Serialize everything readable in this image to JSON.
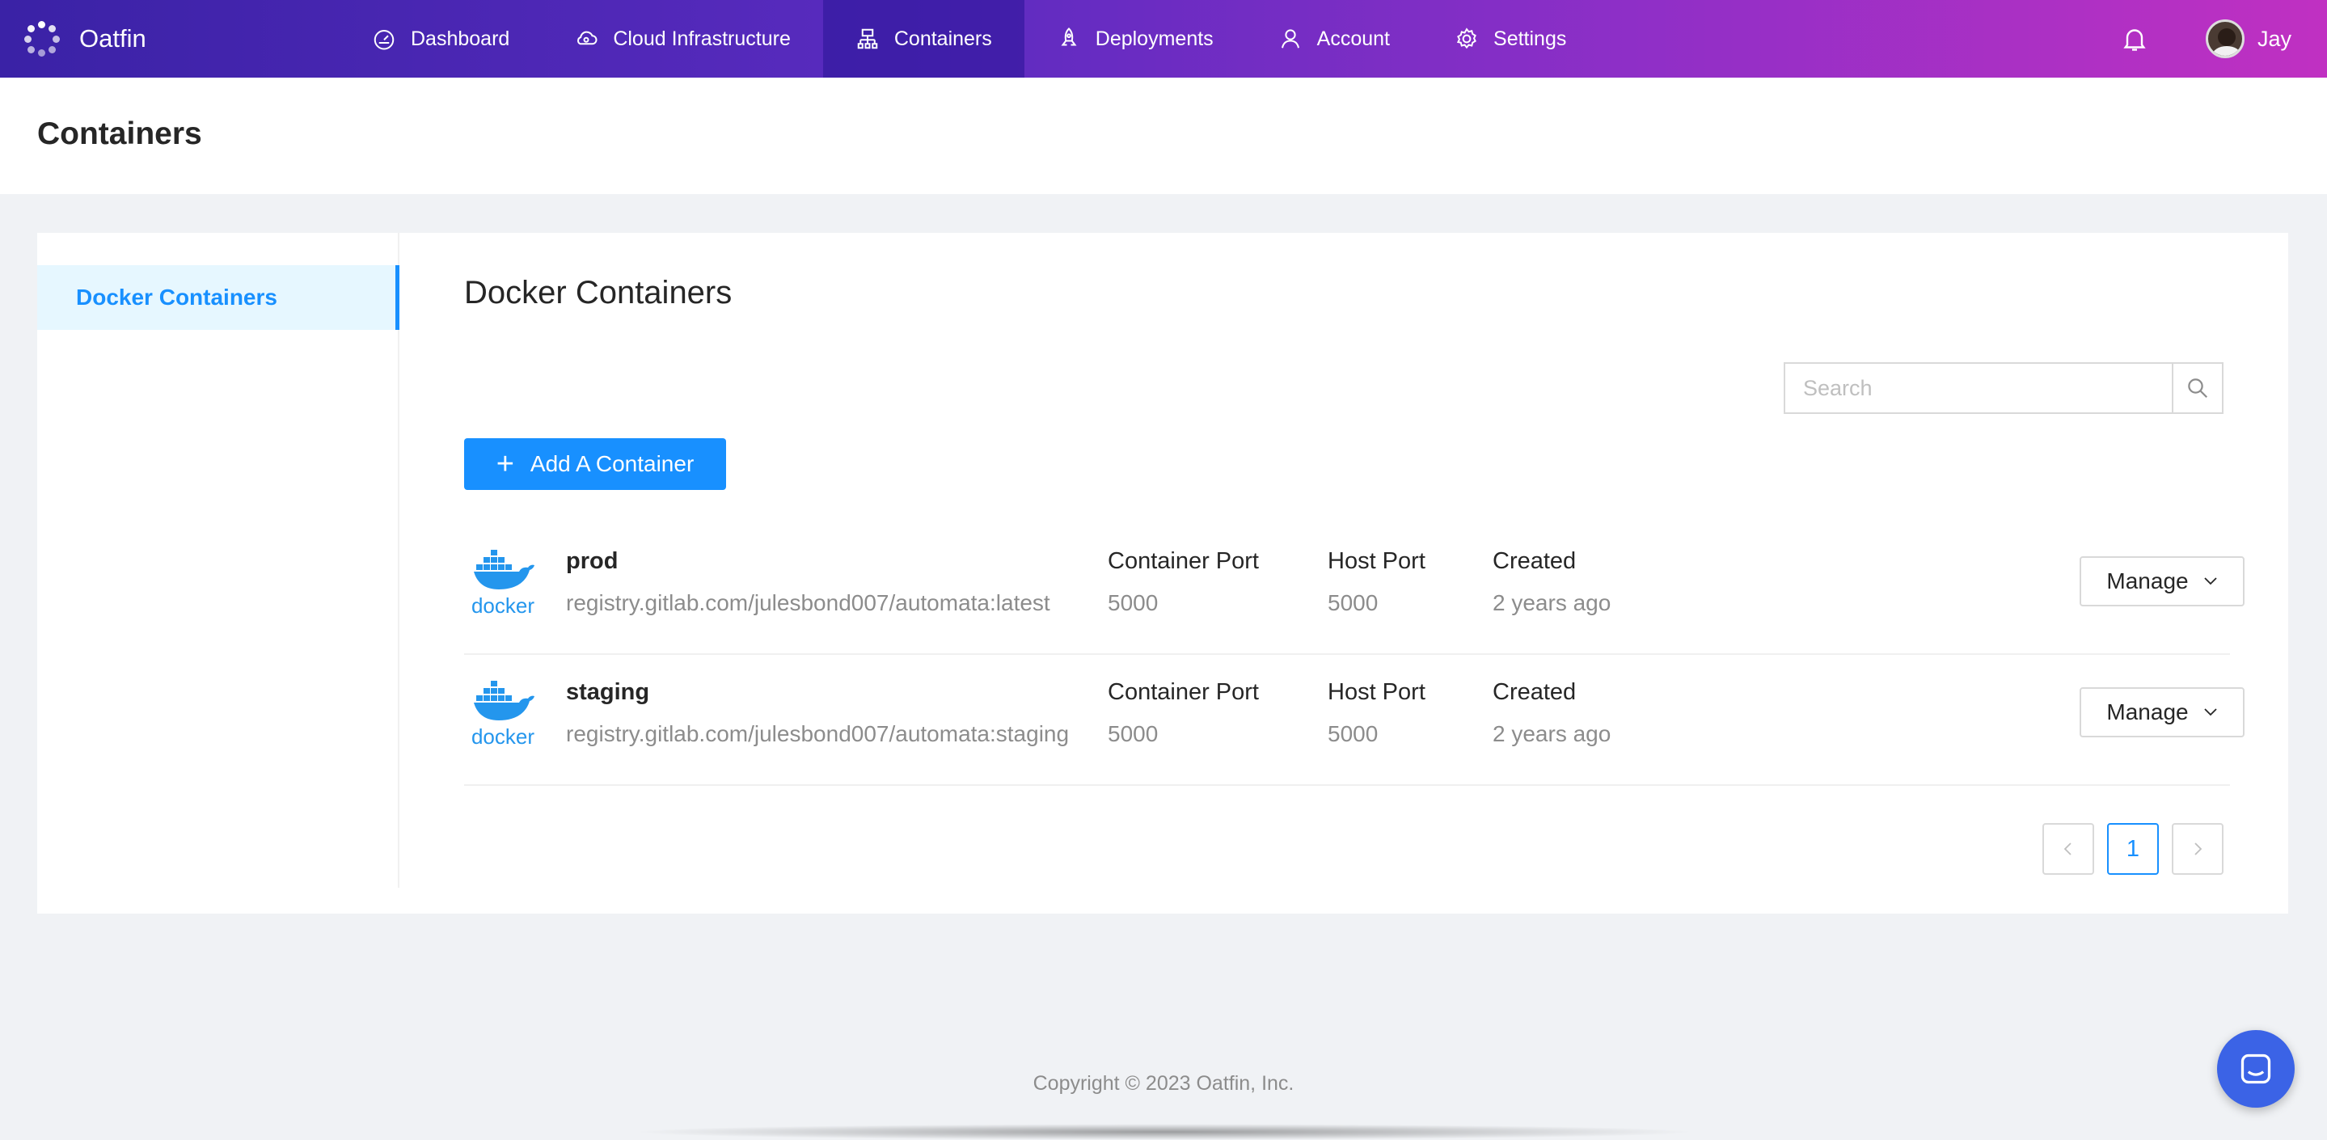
{
  "app": {
    "name": "Oatfin"
  },
  "nav": {
    "items": [
      {
        "label": "Dashboard",
        "icon": "dashboard-icon"
      },
      {
        "label": "Cloud Infrastructure",
        "icon": "cloud-icon"
      },
      {
        "label": "Containers",
        "icon": "containers-icon",
        "active": true
      },
      {
        "label": "Deployments",
        "icon": "rocket-icon"
      },
      {
        "label": "Account",
        "icon": "user-icon"
      },
      {
        "label": "Settings",
        "icon": "gear-icon"
      }
    ],
    "user_name": "Jay"
  },
  "page": {
    "title": "Containers"
  },
  "sidebar": {
    "items": [
      {
        "label": "Docker Containers",
        "active": true
      }
    ]
  },
  "content": {
    "title": "Docker Containers",
    "search_placeholder": "Search",
    "add_button_label": "Add A Container",
    "columns": {
      "container_port": "Container Port",
      "host_port": "Host Port",
      "created": "Created"
    },
    "manage_label": "Manage",
    "containers": [
      {
        "name": "prod",
        "image": "registry.gitlab.com/julesbond007/automata:latest",
        "container_port": "5000",
        "host_port": "5000",
        "created": "2 years ago"
      },
      {
        "name": "staging",
        "image": "registry.gitlab.com/julesbond007/automata:staging",
        "container_port": "5000",
        "host_port": "5000",
        "created": "2 years ago"
      }
    ],
    "pagination": {
      "current_page": "1"
    }
  },
  "footer": {
    "copyright": "Copyright © 2023 Oatfin, Inc."
  },
  "colors": {
    "primary": "#1890ff",
    "nav_gradient_start": "#3a22a6",
    "nav_gradient_end": "#c030c2"
  }
}
